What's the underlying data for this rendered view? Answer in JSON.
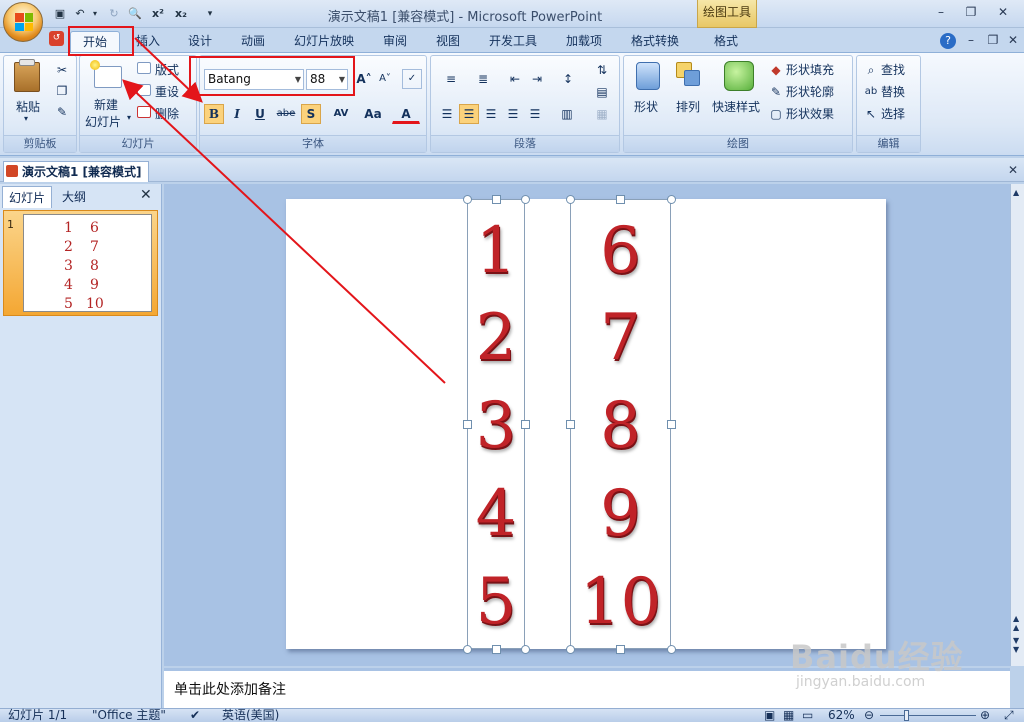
{
  "window": {
    "title": "演示文稿1 [兼容模式] - Microsoft PowerPoint",
    "context_tool": "绘图工具"
  },
  "qat": {
    "superscript": "x²",
    "subscript": "x₂"
  },
  "tabs": [
    "开始",
    "插入",
    "设计",
    "动画",
    "幻灯片放映",
    "审阅",
    "视图",
    "开发工具",
    "加载项",
    "格式转换",
    "格式"
  ],
  "ribbon": {
    "clipboard": {
      "paste": "粘贴",
      "label": "剪贴板"
    },
    "slides": {
      "new_slide_1": "新建",
      "new_slide_2": "幻灯片",
      "layout": "版式",
      "reset": "重设",
      "delete": "删除",
      "label": "幻灯片"
    },
    "font": {
      "font_name": "Batang",
      "font_size": "88",
      "bold": "B",
      "italic": "I",
      "underline": "U",
      "strike": "abe",
      "shadow": "S",
      "spacing": "AV",
      "case": "Aa",
      "color": "A",
      "label": "字体"
    },
    "paragraph": {
      "label": "段落"
    },
    "drawing": {
      "shapes": "形状",
      "arrange": "排列",
      "quick_styles": "快速样式",
      "fill": "形状填充",
      "outline": "形状轮廓",
      "effects": "形状效果",
      "label": "绘图"
    },
    "editing": {
      "find": "查找",
      "replace": "替换",
      "select": "选择",
      "label": "编辑"
    }
  },
  "doc_tab": "演示文稿1 [兼容模式]",
  "pane_tabs": {
    "slides": "幻灯片",
    "outline": "大纲"
  },
  "thumbnail": {
    "index": "1",
    "col1": [
      "1",
      "2",
      "3",
      "4",
      "5"
    ],
    "col2": [
      "6",
      "7",
      "8",
      "9",
      "10"
    ]
  },
  "slide": {
    "col1": [
      "1",
      "2",
      "3",
      "4",
      "5"
    ],
    "col2": [
      "6",
      "7",
      "8",
      "9",
      "10"
    ]
  },
  "notes_placeholder": "单击此处添加备注",
  "status": {
    "slide": "幻灯片 1/1",
    "theme": "\"Office 主题\"",
    "language": "英语(美国)",
    "zoom": "62%"
  },
  "watermark": {
    "brand": "Baidu经验",
    "url": "jingyan.baidu.com"
  }
}
